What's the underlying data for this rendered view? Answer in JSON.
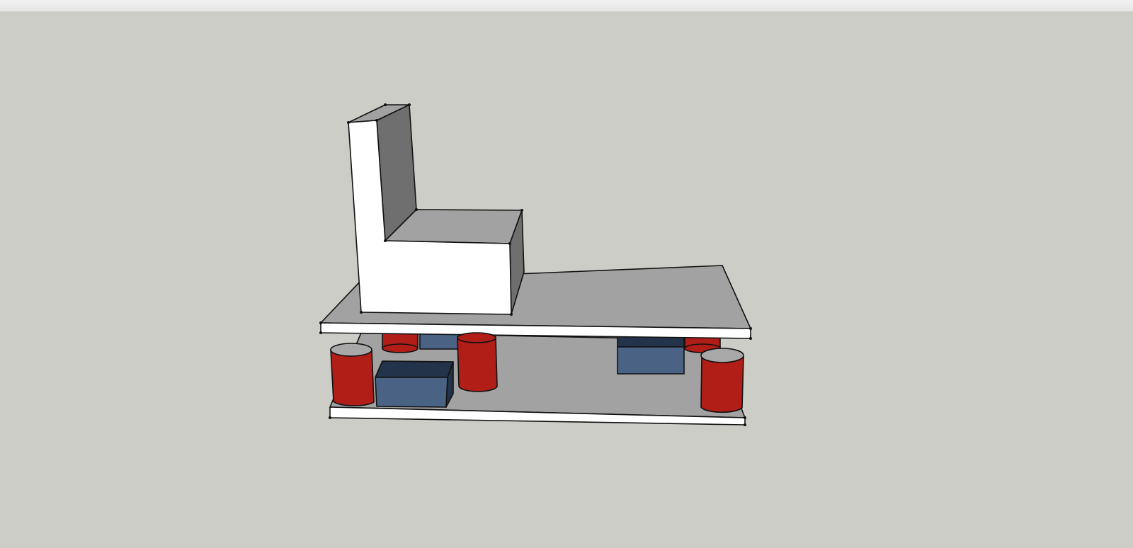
{
  "colors": {
    "viewport_background": "#cdcdc8",
    "top_strip": "#ebebeb",
    "face_white": "#ffffff",
    "face_gray": "#a2a2a2",
    "face_dark_gray": "#6f6f6f",
    "cylinder_red": "#b01e17",
    "cylinder_top": "#a8a8a8",
    "box_blue_front": "#4a6384",
    "box_blue_top": "#22334a",
    "edge": "#111111"
  },
  "scene": {
    "objects": [
      "l-shaped-seat-block",
      "top-platform-slab",
      "bottom-platform-slab",
      "red-cylinder-left-front",
      "red-cylinder-left-back",
      "red-cylinder-middle",
      "red-cylinder-right-front",
      "red-cylinder-right-back",
      "blue-box-left",
      "blue-box-back",
      "blue-box-right"
    ]
  }
}
